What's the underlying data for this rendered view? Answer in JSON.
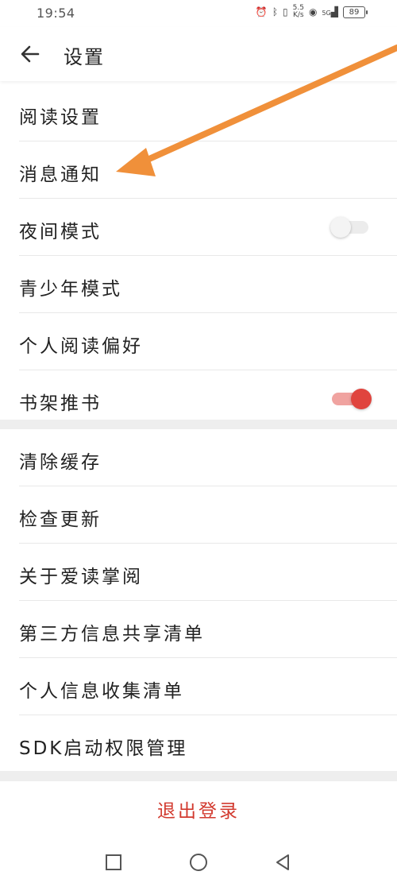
{
  "status_bar": {
    "time": "19:54",
    "net_speed_value": "5.5",
    "net_speed_unit": "K/s",
    "signal_label": "5G",
    "battery": "89"
  },
  "header": {
    "title": "设置"
  },
  "group1": [
    {
      "label": "阅读设置"
    },
    {
      "label": "消息通知"
    },
    {
      "label": "夜间模式",
      "toggle": false
    },
    {
      "label": "青少年模式"
    },
    {
      "label": "个人阅读偏好"
    },
    {
      "label": "书架推书",
      "toggle": true
    }
  ],
  "group2": [
    {
      "label": "清除缓存"
    },
    {
      "label": "检查更新"
    },
    {
      "label": "关于爱读掌阅"
    },
    {
      "label": "第三方信息共享清单"
    },
    {
      "label": "个人信息收集清单"
    },
    {
      "label": "SDK启动权限管理"
    }
  ],
  "logout_label": "退出登录",
  "colors": {
    "accent": "#e0443e",
    "logout": "#d23a2f",
    "annotation_arrow": "#f0903a"
  },
  "icons": [
    "back-arrow-icon",
    "square-nav-icon",
    "circle-nav-icon",
    "triangle-nav-icon"
  ]
}
